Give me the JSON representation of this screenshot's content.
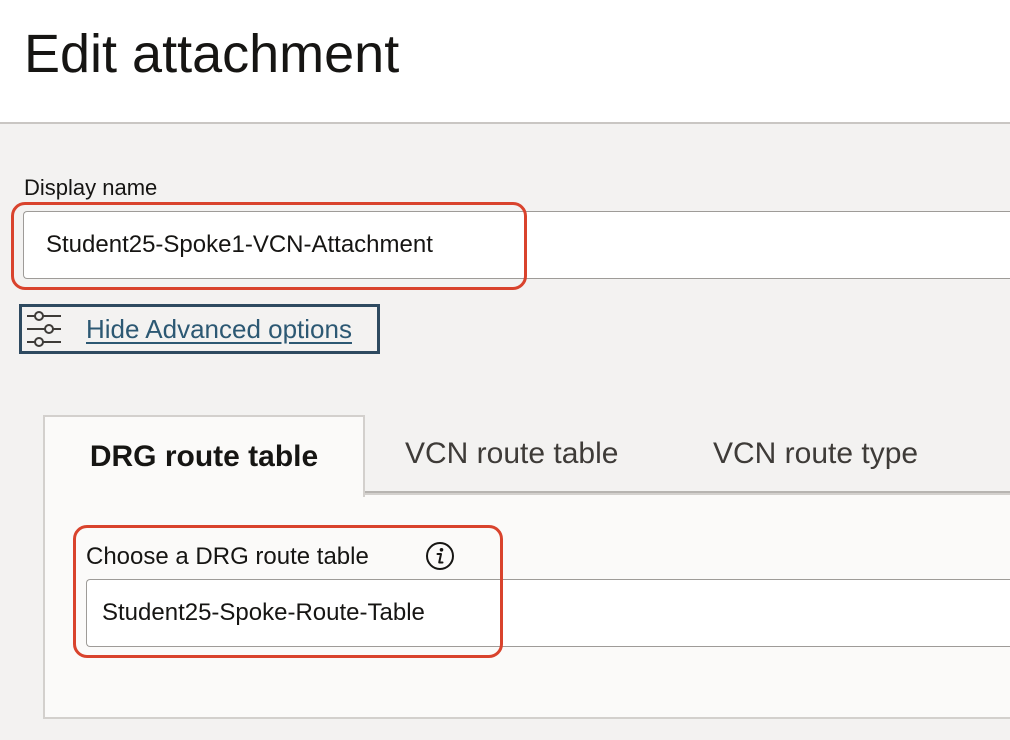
{
  "page": {
    "title": "Edit attachment"
  },
  "display_name": {
    "label": "Display name",
    "value": "Student25-Spoke1-VCN-Attachment"
  },
  "advanced": {
    "link_label": "Hide Advanced options",
    "icon": "sliders-icon"
  },
  "tabs": [
    {
      "label": "DRG route table",
      "active": true
    },
    {
      "label": "VCN route table",
      "active": false
    },
    {
      "label": "VCN route type",
      "active": false
    }
  ],
  "drg_route_table": {
    "label": "Choose a DRG route table",
    "info_icon": "info-icon",
    "value": "Student25-Spoke-Route-Table"
  },
  "colors": {
    "highlight": "#d9432d",
    "link": "#2c5873",
    "focus_border": "#2e4a60"
  }
}
